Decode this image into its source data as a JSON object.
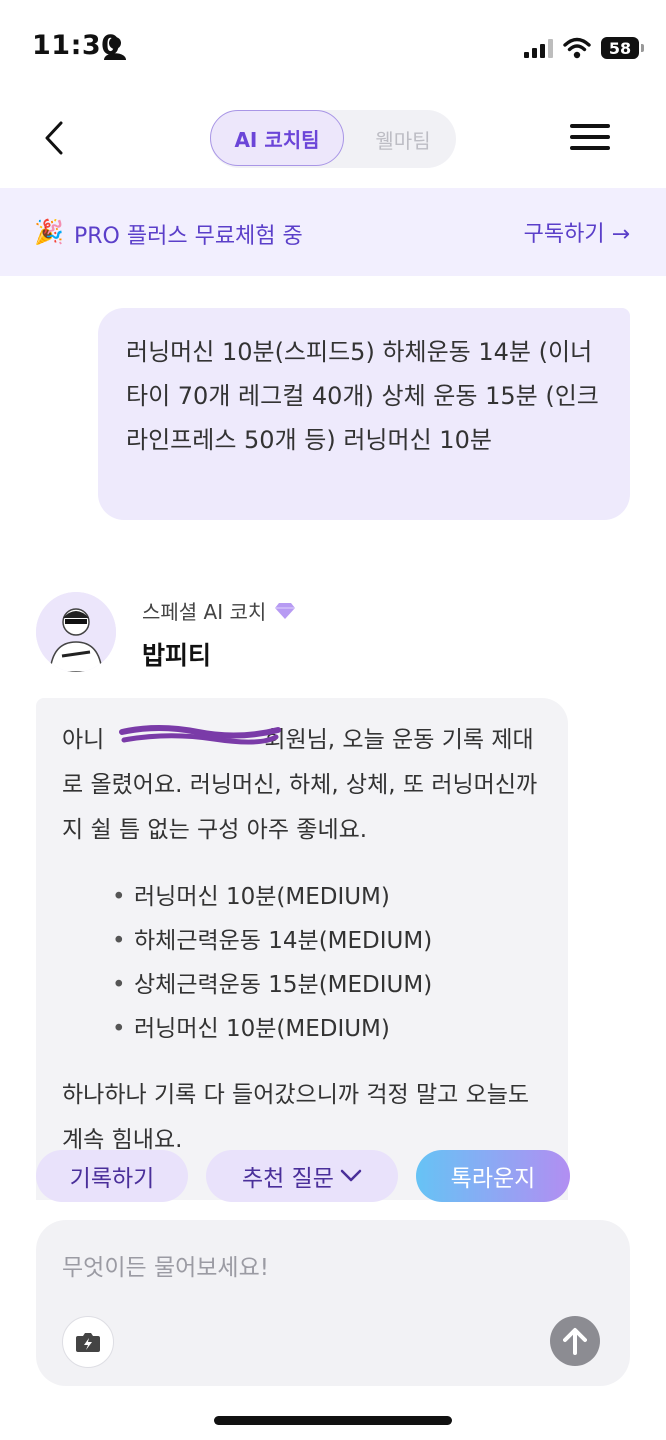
{
  "status_bar": {
    "time": "11:30",
    "battery": "58"
  },
  "nav": {
    "tab_ai": "AI 코치팀",
    "tab_wellma": "웰마팀"
  },
  "promo": {
    "icon": "🎉",
    "text": "PRO 플러스 무료체험 중",
    "link": "구독하기 →"
  },
  "user_message": "러닝머신 10분(스피드5) 하체운동 14분 (이너타이 70개 레그컬 40개) 상체 운동 15분 (인크라인프레스 50개 등) 러닝머신 10분",
  "coach": {
    "role": "스페셜 AI 코치",
    "name": "밥피티"
  },
  "ai_message": {
    "intro_prefix": "아니",
    "intro": "회원님, 오늘 운동 기록 제대로 올렸어요. 러닝머신, 하체, 상체, 또 러닝머신까지 쉴 틈 없는 구성 아주 좋네요.",
    "items": [
      "러닝머신 10분(MEDIUM)",
      "하체근력운동 14분(MEDIUM)",
      "상체근력운동 15분(MEDIUM)",
      "러닝머신 10분(MEDIUM)"
    ],
    "outro": "하나하나 기록 다 들어갔으니까 걱정 말고 오늘도 계속 힘내요."
  },
  "chips": {
    "record": "기록하기",
    "suggest": "추천 질문",
    "chat": "톡라운지"
  },
  "composer": {
    "placeholder": "무엇이든 물어보세요!"
  },
  "colors": {
    "accent": "#6b45d8",
    "promo_bg": "#f2effe",
    "user_bubble": "#eeeafc",
    "ai_bubble": "#f3f3f6"
  }
}
